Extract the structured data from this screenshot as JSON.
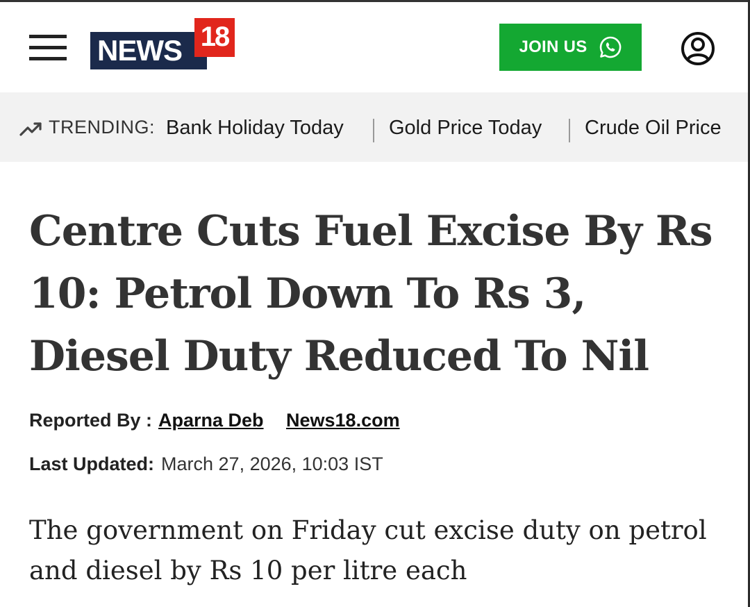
{
  "header": {
    "logo_text": "NEWS",
    "logo_number": "18",
    "join_label": "JOIN US",
    "join_icon": "whatsapp-icon",
    "menu_icon": "hamburger-menu-icon",
    "account_icon": "user-account-icon",
    "brand_color": "#1b2a4b",
    "brand_accent": "#e1261c",
    "join_color": "#14a832"
  },
  "trending": {
    "icon": "trending-up-icon",
    "label": "TRENDING:",
    "items": [
      "Bank Holiday Today",
      "Gold Price Today",
      "Crude Oil Price"
    ]
  },
  "article": {
    "headline": "Centre Cuts Fuel Excise By Rs 10: Petrol Down To Rs 3, Diesel Duty Reduced To Nil",
    "reported_by_label": "Reported By :",
    "author": "Aparna Deb",
    "source": "News18.com",
    "updated_label": "Last Updated:",
    "updated_value": "March 27, 2026, 10:03 IST",
    "summary": "The government on Friday cut excise duty on petrol and diesel by Rs 10 per litre each"
  }
}
